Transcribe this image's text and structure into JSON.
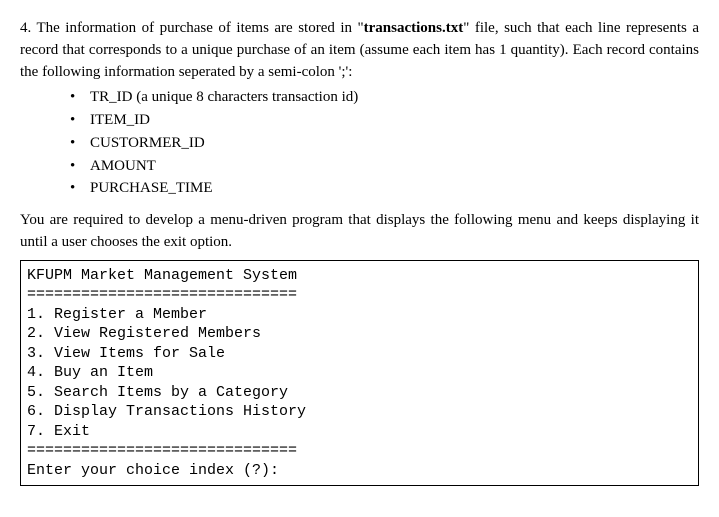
{
  "question": {
    "number": "4.",
    "intro_part1": "The information of purchase of items are stored in \"",
    "filename": "transactions.txt",
    "intro_part2": "\" file, such that each line represents a record that corresponds to a unique purchase of an item (assume each item has 1 quantity). Each record contains the following information seperated by a semi-colon ';':",
    "fields": [
      "TR_ID (a unique 8 characters transaction id)",
      "ITEM_ID",
      "CUSTORMER_ID",
      "AMOUNT",
      "PURCHASE_TIME"
    ],
    "requirement": "You are required to develop a menu-driven program that displays the following menu and keeps displaying it until a user chooses the exit option."
  },
  "menu": {
    "title": "KFUPM Market Management System",
    "divider": "==============================",
    "options": [
      "1. Register a Member",
      "2. View Registered Members",
      "3. View Items for Sale",
      "4. Buy an Item",
      "5. Search Items by a Category",
      "6. Display Transactions History",
      "7. Exit"
    ],
    "prompt": "Enter your choice index (?):"
  }
}
